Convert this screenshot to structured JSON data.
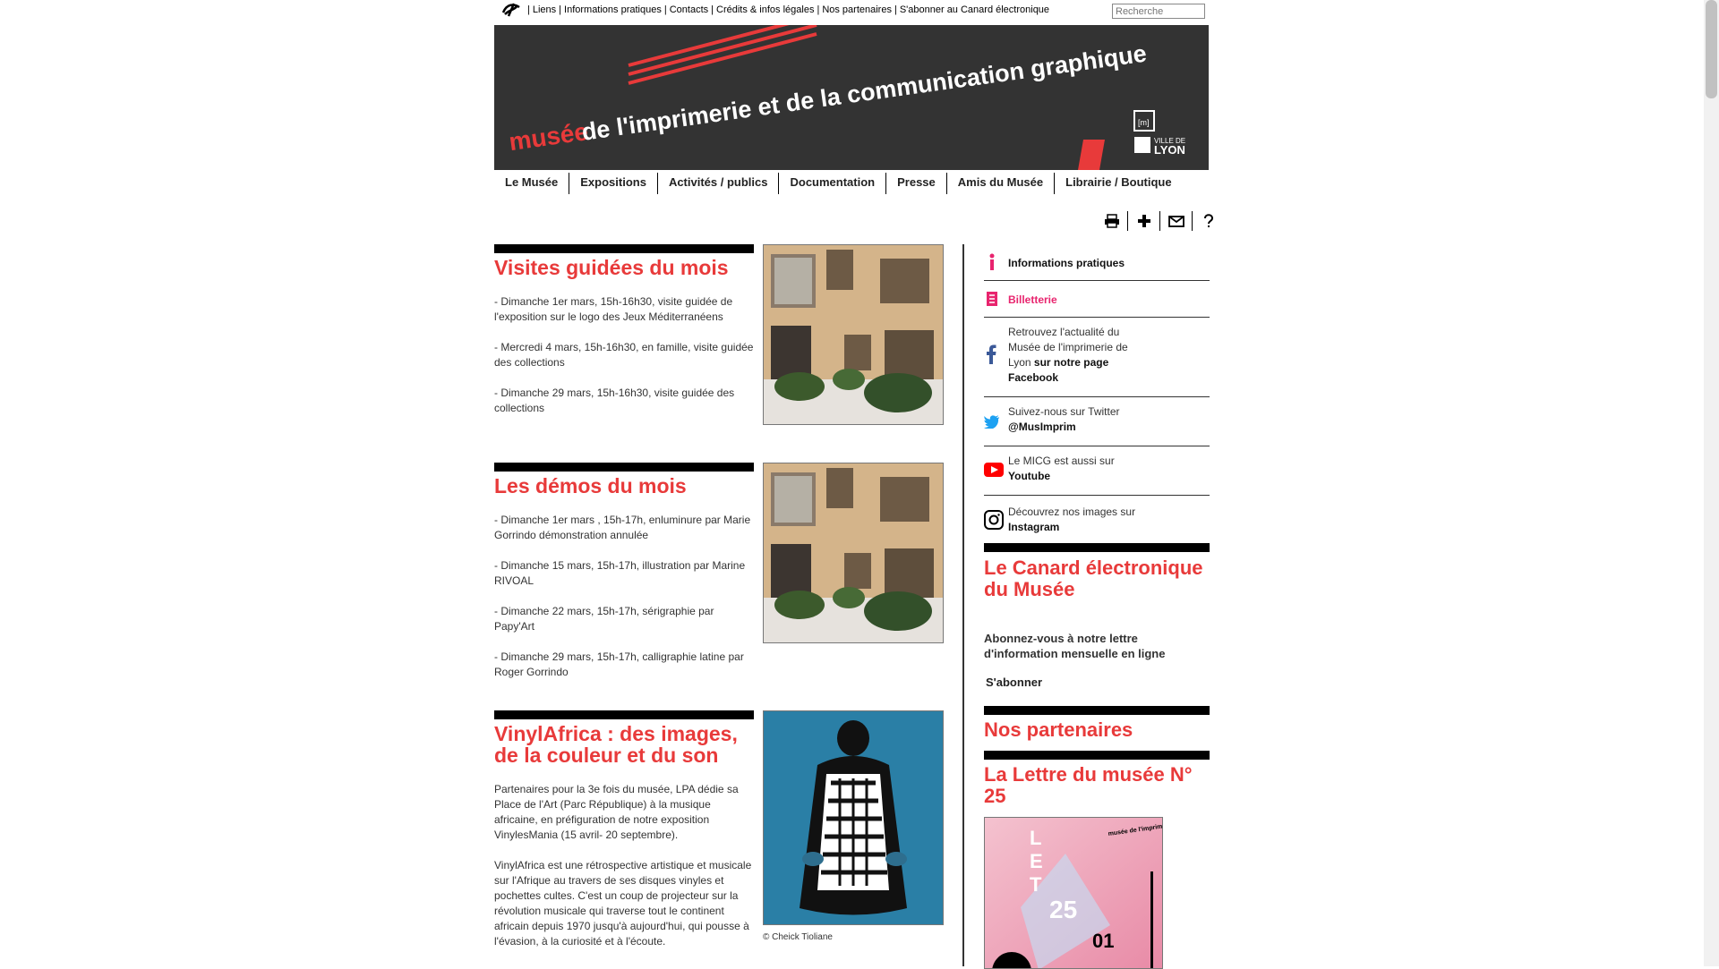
{
  "topbar": {
    "links": [
      "Liens",
      "Informations pratiques",
      "Contacts",
      "Crédits & infos légales",
      "Nos partenaires",
      "S'abonner au Canard électronique"
    ],
    "search_placeholder": "Recherche"
  },
  "banner": {
    "line1": "musée",
    "line2": "de l'imprimerie et de la communication graphique",
    "ville_de": "VILLE DE",
    "lyon": "LYON",
    "brand_color": "#e83a3a",
    "bg_color": "#333333"
  },
  "mainnav": [
    "Le Musée",
    "Expositions",
    "Activités / publics",
    "Documentation",
    "Presse",
    "Amis du Musée",
    "Librairie / Boutique"
  ],
  "tools": [
    "print-icon",
    "plus-icon",
    "mail-icon",
    "help-icon"
  ],
  "articles": [
    {
      "title": "Visites guidées du mois",
      "paragraphs": [
        "- Dimanche 1er mars, 15h-16h30, visite guidée de l'exposition sur le logo des Jeux Méditerranéens",
        "- Mercredi 4 mars, 15h-16h30, en famille, visite guidée des collections",
        "- Dimanche 29 mars, 15h-16h30, visite guidée des collections"
      ]
    },
    {
      "title": "Les démos du mois",
      "paragraphs": [
        "- Dimanche 1er mars , 15h-17h, enluminure par Marie Gorrindo démonstration annulée",
        "- Dimanche 15 mars, 15h-17h, illustration par Marine RIVOAL",
        "- Dimanche 22 mars, 15h-17h, sérigraphie par Papy'Art",
        "- Dimanche 29 mars, 15h-17h, calligraphie latine par Roger Gorrindo"
      ]
    },
    {
      "title": "VinylAfrica : des images, de la couleur et du son",
      "paragraphs": [
        "Partenaires pour la 3e fois du musée, LPA dédie sa Place de l'Art (Parc République) à la musique africaine, en préfiguration de notre exposition VinylesMania (15 avril- 20 septembre).",
        "VinylAfrica est une rétrospective artistique et musicale sur l'Afrique au travers de ses disques vinyles et pochettes cultes. C'est un coup de projecteur sur la révolution musicale qui traverse tout le continent africain depuis 1970 jusqu'à aujourd'hui, qui pousse à l'évasion, à la curiosité et à l'écoute."
      ],
      "credit": "© Cheick Tioliane"
    }
  ],
  "sidebar": {
    "info": "Informations pratiques",
    "billetterie": "Billetterie",
    "facebook_text": "Retrouvez l'actualité du Musée de l'imprimerie de Lyon",
    "facebook_bold": "sur notre page Facebook",
    "twitter_text": "Suivez-nous sur Twitter",
    "twitter_bold": "@MusImprim",
    "youtube_text": "Le MICG est aussi sur",
    "youtube_bold": "Youtube",
    "instagram_text": "Découvrez nos images sur",
    "instagram_bold": "Instagram",
    "canard_title": "Le Canard électronique du Musée",
    "canard_desc": "Abonnez-vous à notre lettre d'information mensuelle en ligne",
    "subscribe": "S'abonner",
    "partners_title": "Nos partenaires",
    "lettre_title": "La Lettre du musée N° 25",
    "cover_text": "musée de l'imprimerie et de la communication graphique"
  }
}
